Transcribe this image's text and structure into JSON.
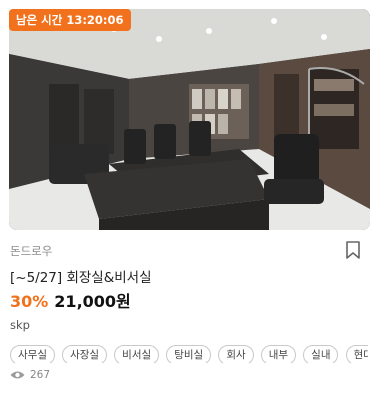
{
  "product": {
    "timer_text": "남은 시간 13:20:06",
    "image_alt": "회장실 사무실 3D 장면",
    "seller": "돈드로우",
    "title": "[~5/27] 회장실&비서실",
    "discount": "30%",
    "price": "21,000원",
    "brand": "skp",
    "tags": [
      "사무실",
      "사장실",
      "비서실",
      "탕비실",
      "회사",
      "내부",
      "실내",
      "현대둘"
    ],
    "views": "267"
  },
  "colors": {
    "accent": "#f2711c",
    "text": "#222222",
    "muted": "#8a8a8a"
  },
  "icons": {
    "bookmark": "bookmark-icon",
    "views": "eye-icon"
  }
}
